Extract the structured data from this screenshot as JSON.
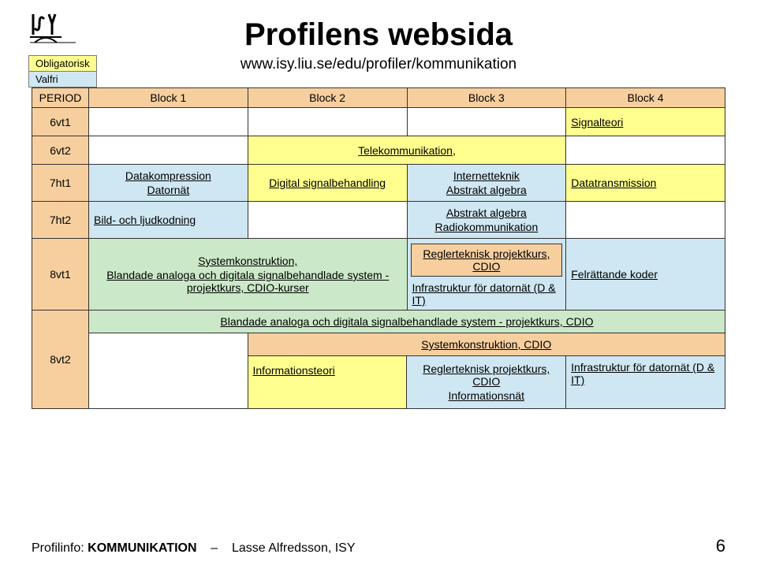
{
  "title": "Profilens websida",
  "url": "www.isy.liu.se/edu/profiler/kommunikation",
  "legend": {
    "obligatorisk": "Obligatorisk",
    "valfri": "Valfri"
  },
  "header": {
    "period": "PERIOD",
    "b1": "Block 1",
    "b2": "Block 2",
    "b3": "Block 3",
    "b4": "Block 4"
  },
  "periods": {
    "p6vt1": "6vt1",
    "p6vt2": "6vt2",
    "p7ht1": "7ht1",
    "p7ht2": "7ht2",
    "p8vt1": "8vt1",
    "p8vt2": "8vt2"
  },
  "courses": {
    "signalteori": "Signalteori",
    "telekom": "Telekommunikation,",
    "datakompression": "Datakompression",
    "datornat": "Datornät",
    "digital_signal": "Digital signalbehandling",
    "internetteknik": "Internetteknik",
    "abstrakt_algebra1": "Abstrakt algebra",
    "datatransmission": "Datatransmission",
    "bild_ljud": "Bild- och ljudkodning",
    "abstrakt_algebra2": "Abstrakt algebra",
    "radiokomm": "Radiokommunikation",
    "systemkonstruktion": "Systemkonstruktion,",
    "blandade_cdio_kurser": "Blandade analoga och digitala signalbehandlade system - projektkurs, CDIO-kurser",
    "reglerteknisk_cdio": "Reglerteknisk projektkurs, CDIO",
    "infrastruktur_dit": "Infrastruktur för datornät (D & IT)",
    "felrattande": "Felrättande koder",
    "blandade_full": "Blandade analoga och digitala signalbehandlade system - projektkurs, CDIO",
    "systemkonstruktion_cdio": "Systemkonstruktion, CDIO",
    "informationsteori": "Informationsteori",
    "reglerteknisk_cdio2": "Reglerteknisk projektkurs, CDIO",
    "informationsnat": "Informationsnät",
    "infrastruktur_dit2": "Infrastruktur för datornät (D & IT)"
  },
  "footer": {
    "profilinfo_label": "Profilinfo:",
    "profilinfo_value": "KOMMUNIKATION",
    "sep": "–",
    "author": "Lasse Alfredsson, ISY",
    "page": "6"
  }
}
